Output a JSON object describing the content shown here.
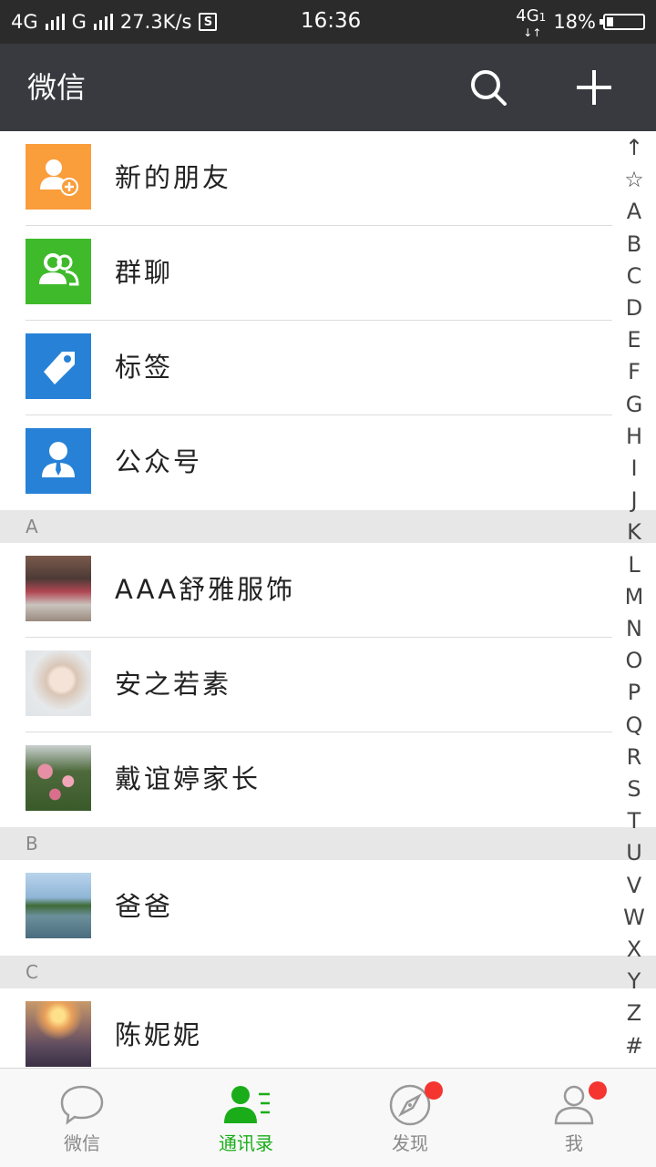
{
  "status_bar": {
    "network_left": "4G",
    "network_second": "G",
    "speed": "27.3K/s",
    "s_icon": "S",
    "time": "16:36",
    "network_right": "4G",
    "network_right_sub": "1",
    "battery": "18%",
    "battery_level": 0.18
  },
  "header": {
    "title": "微信",
    "search_icon": "search-icon",
    "add_icon": "plus-icon"
  },
  "functions": [
    {
      "label": "新的朋友",
      "icon": "add-friend-icon",
      "color": "#fa9d3b"
    },
    {
      "label": "群聊",
      "icon": "group-chat-icon",
      "color": "#3fba2b"
    },
    {
      "label": "标签",
      "icon": "tag-icon",
      "color": "#2782d7"
    },
    {
      "label": "公众号",
      "icon": "official-account-icon",
      "color": "#2782d7"
    }
  ],
  "sections": [
    {
      "letter": "A",
      "contacts": [
        "AAA舒雅服饰",
        "安之若素",
        "戴谊婷家长"
      ]
    },
    {
      "letter": "B",
      "contacts": [
        "爸爸"
      ]
    },
    {
      "letter": "C",
      "contacts": [
        "陈妮妮"
      ]
    }
  ],
  "index_letters": [
    "↑",
    "☆",
    "A",
    "B",
    "C",
    "D",
    "E",
    "F",
    "G",
    "H",
    "I",
    "J",
    "K",
    "L",
    "M",
    "N",
    "O",
    "P",
    "Q",
    "R",
    "S",
    "T",
    "U",
    "V",
    "W",
    "X",
    "Y",
    "Z",
    "#"
  ],
  "tabs": [
    {
      "label": "微信",
      "icon": "chat-bubble-icon",
      "active": false,
      "badge": false
    },
    {
      "label": "通讯录",
      "icon": "contacts-icon",
      "active": true,
      "badge": false
    },
    {
      "label": "发现",
      "icon": "compass-icon",
      "active": false,
      "badge": true
    },
    {
      "label": "我",
      "icon": "profile-icon",
      "active": false,
      "badge": true
    }
  ],
  "colors": {
    "title_bar": "#383a3f",
    "status_bar": "#2b2b2b",
    "accent_green": "#1aad19",
    "badge_red": "#f43530",
    "section_bg": "#e7e7e7"
  }
}
